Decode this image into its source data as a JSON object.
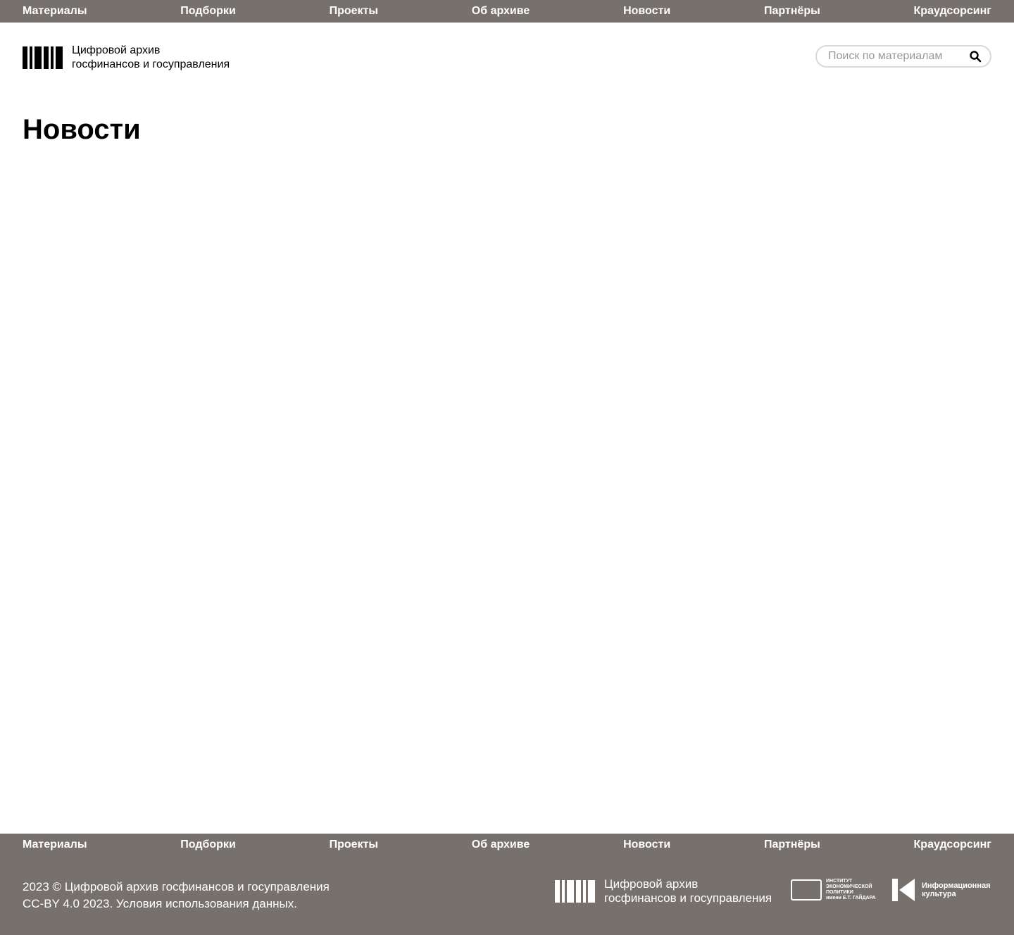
{
  "nav": {
    "items": [
      "Материалы",
      "Подборки",
      "Проекты",
      "Об архиве",
      "Новости",
      "Партнёры",
      "Краудсорсинг"
    ]
  },
  "header": {
    "logo_mark": "ЦАГГ",
    "logo_line1": "Цифровой архив",
    "logo_line2": "госфинансов и госуправления"
  },
  "search": {
    "placeholder": "Поиск по материалам",
    "icon": "search-icon"
  },
  "page": {
    "title": "Новости"
  },
  "footer": {
    "nav_items": [
      "Материалы",
      "Подборки",
      "Проекты",
      "Об архиве",
      "Новости",
      "Партнёры",
      "Краудсорсинг"
    ],
    "copyright_line1": "2023 © Цифровой архив госфинансов и госуправления",
    "copyright_line2": "CC-BY 4.0 2023. Условия использования данных.",
    "logo_line1": "Цифровой архив",
    "logo_line2": "госфинансов и госуправления",
    "partner1_lines": [
      "ИНСТИТУТ",
      "ЭКОНОМИЧЕСКОЙ",
      "ПОЛИТИКИ",
      "имени Е.Т. ГАЙДАРА"
    ],
    "partner2_lines": [
      "Информационная",
      "культура"
    ]
  },
  "colors": {
    "bar_bg": "#77716e",
    "text_light": "#ffffff"
  }
}
